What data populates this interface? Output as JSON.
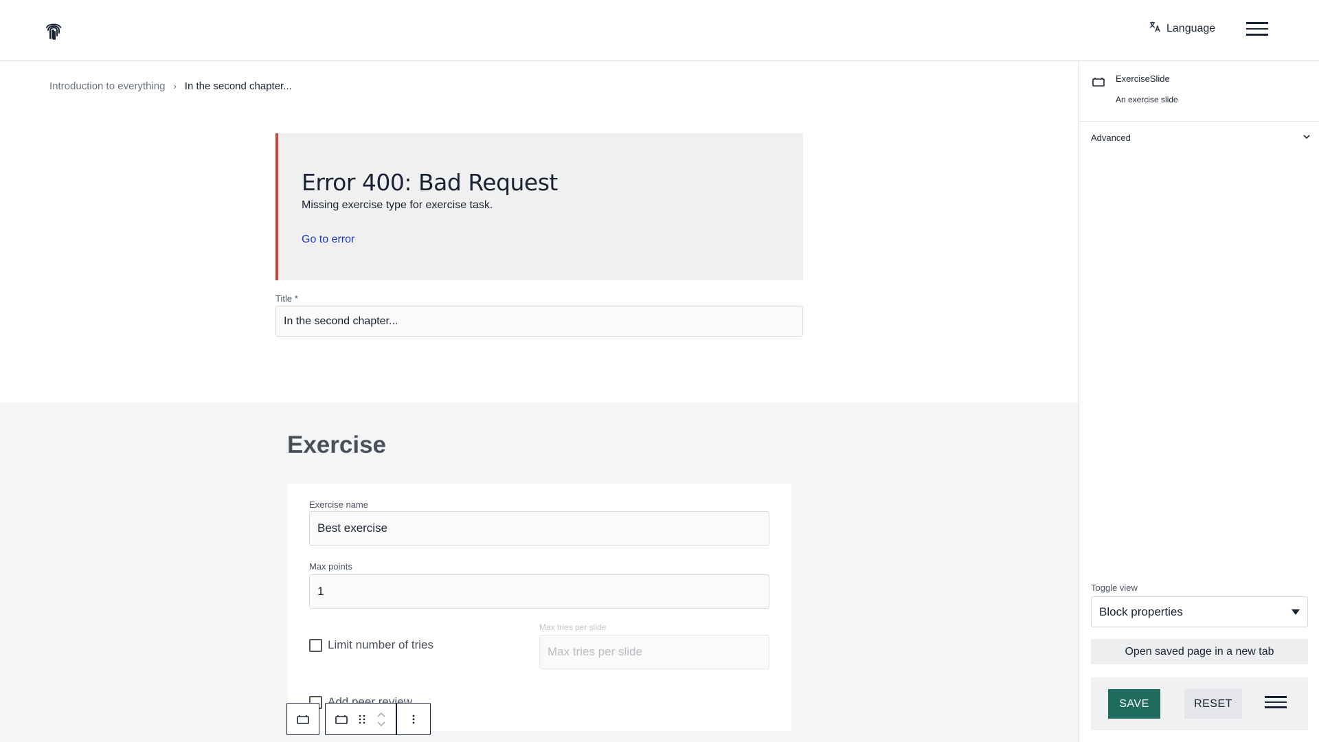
{
  "header": {
    "logo_icon": "fingerprint-icon",
    "language_label": "Language",
    "language_icon": "translate-icon",
    "menu_icon": "hamburger-menu-icon"
  },
  "breadcrumb": {
    "parent": "Introduction to everything",
    "separator": "›",
    "current": "In the second chapter..."
  },
  "error": {
    "title": "Error 400: Bad Request",
    "message": "Missing exercise type for exercise task.",
    "link": "Go to error",
    "accent_color": "#d0453a"
  },
  "title_field": {
    "label": "Title *",
    "value": "In the second chapter..."
  },
  "exercise": {
    "heading": "Exercise",
    "name_label": "Exercise name",
    "name_value": "Best exercise",
    "max_points_label": "Max points",
    "max_points_value": "1",
    "limit_tries_label": "Limit number of tries",
    "max_tries_label": "Max tries per slide",
    "max_tries_placeholder": "Max tries per slide",
    "peer_review_label": "Add peer review"
  },
  "sidebar": {
    "block_name": "ExerciseSlide",
    "block_description": "An exercise slide",
    "advanced_label": "Advanced",
    "toggle_view_label": "Toggle view",
    "toggle_view_value": "Block properties",
    "open_tab_label": "Open saved page in a new tab",
    "save_label": "SAVE",
    "reset_label": "RESET",
    "save_color": "#1f6b5e"
  }
}
